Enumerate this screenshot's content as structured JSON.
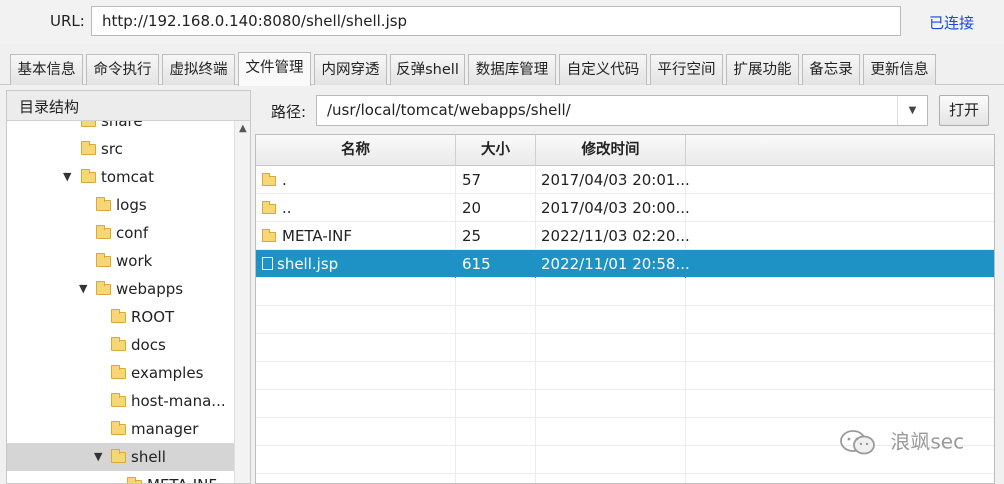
{
  "url_bar": {
    "label": "URL:",
    "value": "http://192.168.0.140:8080/shell/shell.jsp",
    "status": "已连接"
  },
  "tabs": [
    "基本信息",
    "命令执行",
    "虚拟终端",
    "文件管理",
    "内网穿透",
    "反弹shell",
    "数据库管理",
    "自定义代码",
    "平行空间",
    "扩展功能",
    "备忘录",
    "更新信息"
  ],
  "active_tab": "文件管理",
  "tree": {
    "header": "目录结构",
    "items": [
      {
        "label": "share",
        "expanded": null
      },
      {
        "label": "src",
        "expanded": null
      },
      {
        "label": "tomcat",
        "expanded": true
      },
      {
        "label": "logs",
        "expanded": null
      },
      {
        "label": "conf",
        "expanded": null
      },
      {
        "label": "work",
        "expanded": null
      },
      {
        "label": "webapps",
        "expanded": true
      },
      {
        "label": "ROOT",
        "expanded": null
      },
      {
        "label": "docs",
        "expanded": null
      },
      {
        "label": "examples",
        "expanded": null
      },
      {
        "label": "host-mana...",
        "expanded": null
      },
      {
        "label": "manager",
        "expanded": null
      },
      {
        "label": "shell",
        "expanded": true
      },
      {
        "label": "META-INF",
        "expanded": null
      }
    ]
  },
  "path": {
    "label": "路径:",
    "value": "/usr/local/tomcat/webapps/shell/",
    "open_button": "打开"
  },
  "file_table": {
    "columns": [
      "名称",
      "大小",
      "修改时间",
      ""
    ],
    "rows": [
      {
        "name": ".",
        "size": "57",
        "mtime": "2017/04/03 20:01...",
        "type": "folder"
      },
      {
        "name": "..",
        "size": "20",
        "mtime": "2017/04/03 20:00...",
        "type": "folder"
      },
      {
        "name": "META-INF",
        "size": "25",
        "mtime": "2022/11/03 02:20...",
        "type": "folder"
      },
      {
        "name": "shell.jsp",
        "size": "615",
        "mtime": "2022/11/01 20:58...",
        "type": "file"
      }
    ],
    "selected_row": "shell.jsp"
  },
  "watermark": "浪飒sec",
  "colors": {
    "accent": "#1e92c5",
    "link": "#1a48d9",
    "folder": "#f7d676"
  }
}
